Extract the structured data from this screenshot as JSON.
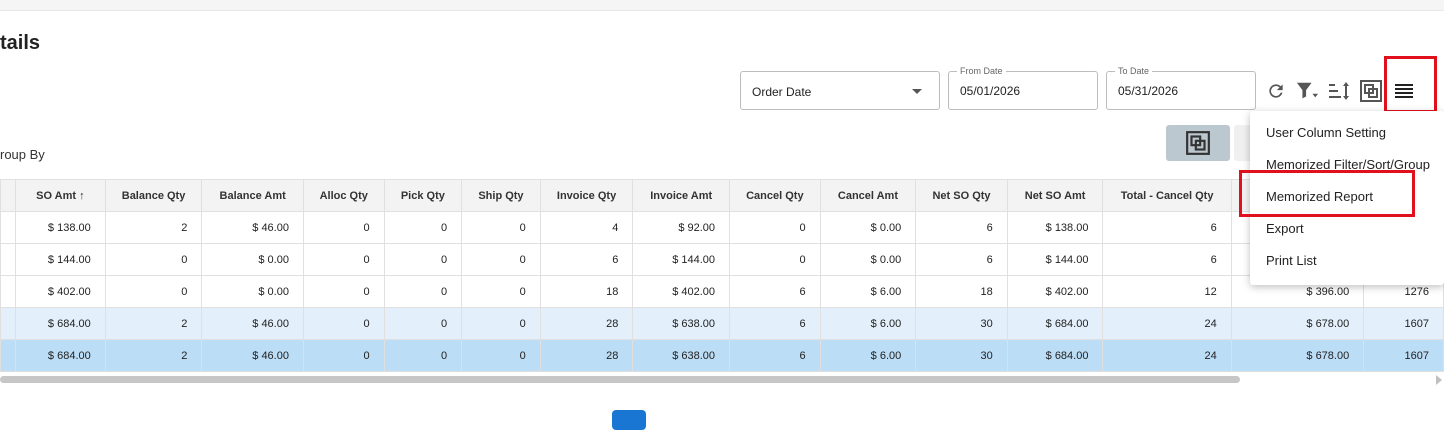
{
  "page": {
    "title": "tails",
    "group_by": "roup By"
  },
  "filters": {
    "date_type": "Order Date",
    "from_label": "From Date",
    "from_value": "05/01/2026",
    "to_label": "To Date",
    "to_value": "05/31/2026"
  },
  "toolbar": {
    "icons": [
      "refresh-icon",
      "filter-icon",
      "sort-icon",
      "group-icon",
      "menu-icon"
    ]
  },
  "table": {
    "columns": [
      "SO Amt ↑",
      "Balance Qty",
      "Balance Amt",
      "Alloc Qty",
      "Pick Qty",
      "Ship Qty",
      "Invoice Qty",
      "Invoice Amt",
      "Cancel Qty",
      "Cancel Amt",
      "Net SO Qty",
      "Net SO Amt",
      "Total - Cancel Qty",
      "",
      ""
    ],
    "rows": [
      {
        "cells": [
          "$ 138.00",
          "2",
          "$ 46.00",
          "0",
          "0",
          "0",
          "4",
          "$ 92.00",
          "0",
          "$ 0.00",
          "6",
          "$ 138.00",
          "6",
          "",
          ""
        ]
      },
      {
        "cells": [
          "$ 144.00",
          "0",
          "$ 0.00",
          "0",
          "0",
          "0",
          "6",
          "$ 144.00",
          "0",
          "$ 0.00",
          "6",
          "$ 144.00",
          "6",
          "",
          ""
        ]
      },
      {
        "cells": [
          "$ 402.00",
          "0",
          "$ 0.00",
          "0",
          "0",
          "0",
          "18",
          "$ 402.00",
          "6",
          "$ 6.00",
          "18",
          "$ 402.00",
          "12",
          "$ 396.00",
          "1276"
        ]
      },
      {
        "cells": [
          "$ 684.00",
          "2",
          "$ 46.00",
          "0",
          "0",
          "0",
          "28",
          "$ 638.00",
          "6",
          "$ 6.00",
          "30",
          "$ 684.00",
          "24",
          "$ 678.00",
          "1607"
        ]
      },
      {
        "cells": [
          "$ 684.00",
          "2",
          "$ 46.00",
          "0",
          "0",
          "0",
          "28",
          "$ 638.00",
          "6",
          "$ 6.00",
          "30",
          "$ 684.00",
          "24",
          "$ 678.00",
          "1607"
        ]
      }
    ]
  },
  "menu": {
    "items": [
      "User Column Setting",
      "Memorized Filter/Sort/Group",
      "Memorized Report",
      "Export",
      "Print List"
    ]
  },
  "colors": {
    "highlight": "#e0101d",
    "selected_row": "#bcddf6",
    "hover_row": "#e3f0fb",
    "primary": "#1976d2"
  }
}
